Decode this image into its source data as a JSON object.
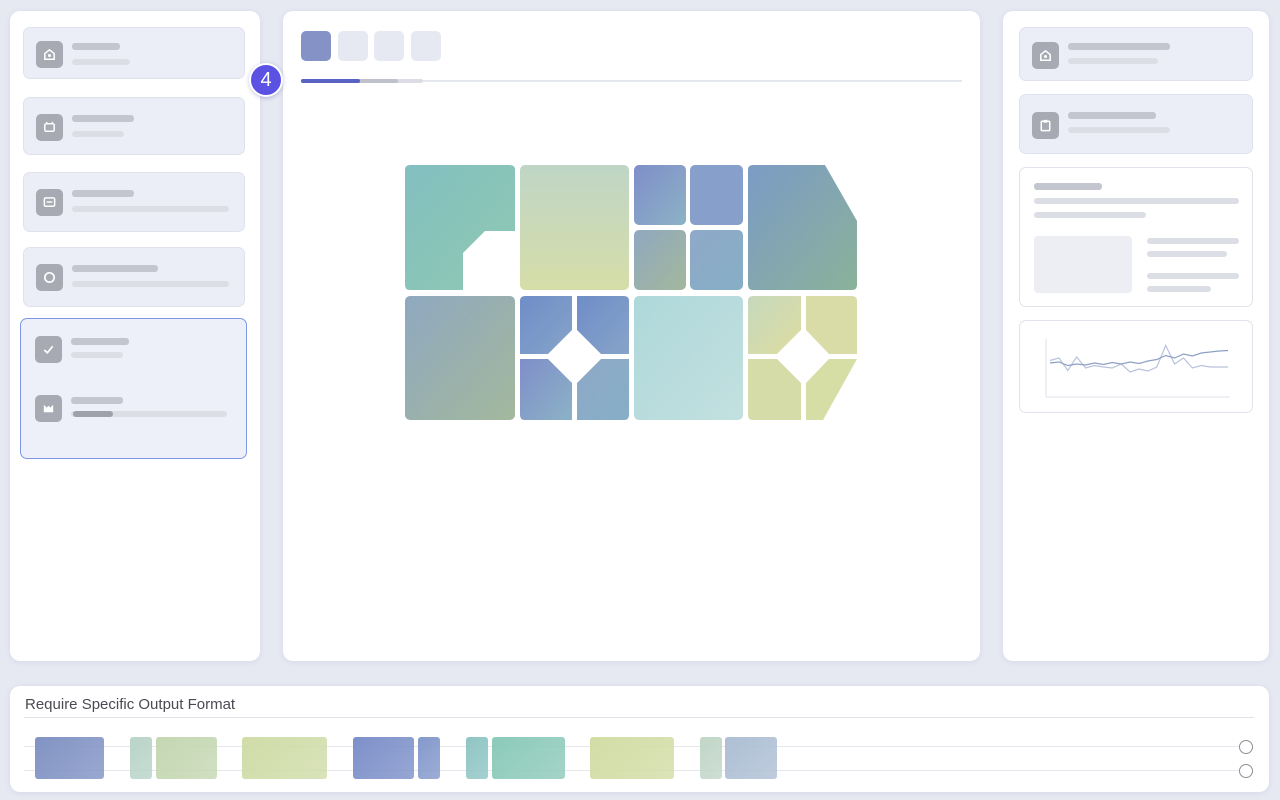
{
  "bottom": {
    "title": "Require Specific Output Format",
    "clip_colors": [
      "#8193c4",
      "#b9d4c9",
      "#c4d7b2",
      "#d0dca8",
      "#7d90c9",
      "#8499cc",
      "#8fc5c4",
      "#8ccab9",
      "#d2dda5",
      "#c1d6c7",
      "#aebfd4"
    ]
  },
  "step": {
    "badge": "4",
    "progress": 0.09
  },
  "colors": {
    "accent": "#5b52e3",
    "selected_border": "#7f98e6",
    "tile_teal": "#8bc2bf",
    "tile_sage": "#c8d9b8",
    "tile_blue": "#7f93c9",
    "tile_aqua": "#b3dad8",
    "tile_lime": "#d3dca8"
  },
  "icons": {
    "left_cards": [
      "home-icon",
      "layout-icon",
      "chat-icon",
      "circle-icon",
      "check-icon",
      "puzzle-icon"
    ],
    "right_cards": [
      "home-icon",
      "clipboard-icon"
    ]
  },
  "sparkline": {
    "series": [
      [
        0.35,
        0.3,
        0.55,
        0.28,
        0.5,
        0.45,
        0.48,
        0.5,
        0.42,
        0.58,
        0.52,
        0.56,
        0.48,
        0.05,
        0.42,
        0.3,
        0.5,
        0.45,
        0.48,
        0.48,
        0.48
      ],
      [
        0.4,
        0.38,
        0.45,
        0.42,
        0.44,
        0.4,
        0.43,
        0.39,
        0.42,
        0.38,
        0.41,
        0.36,
        0.33,
        0.25,
        0.3,
        0.22,
        0.26,
        0.2,
        0.18,
        0.16,
        0.15
      ]
    ]
  }
}
